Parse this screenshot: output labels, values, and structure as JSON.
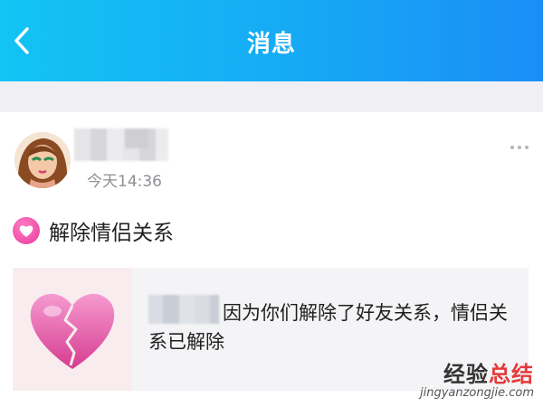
{
  "header": {
    "title": "消息",
    "back_icon": "chevron-left-icon",
    "background": "#16a9f5"
  },
  "post": {
    "author_name_redacted": true,
    "time": "今天14:36",
    "more_icon": "more-dots-icon",
    "notice_title": "解除情侣关系",
    "notice_icon": "heart-icon",
    "accent_color": "#e9389b"
  },
  "message": {
    "thumbnail_icon": "broken-heart-icon",
    "text": "因为你们解除了好友关系，情侣关系已解除"
  },
  "watermark": {
    "main_part1": "经验",
    "main_part2": "总结",
    "sub": "jingyanzongjie.com"
  }
}
